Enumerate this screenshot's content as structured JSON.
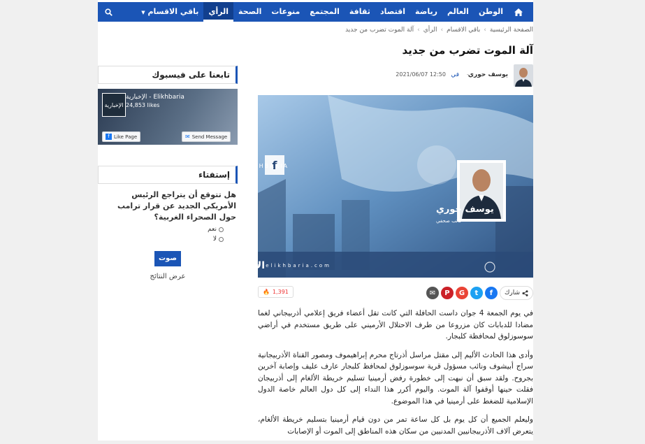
{
  "nav": {
    "items": [
      "الوطن",
      "العالم",
      "رياضة",
      "اقتصاد",
      "ثقافة",
      "المجتمع",
      "منوعات",
      "الصحة",
      "الرأي",
      "باقي الاقسام"
    ],
    "active_index": 8,
    "more_label": "باقي الاقسام",
    "home_icon": "home-icon",
    "search_icon": "search-icon"
  },
  "breadcrumb": [
    "الصفحة الرئيسية",
    "باقي الاقسام",
    "الرأي",
    "آلة الموت تضرب من جديد"
  ],
  "article": {
    "title": "آلة الموت تضرب من جديد",
    "author": "يوسف حوري",
    "preposition": "في",
    "date": "2021/06/07 12:50",
    "share_label": "شارك",
    "views": "1,391",
    "hero": {
      "name": "يوسف حوري",
      "role": "كاتب صحفي",
      "brand": "ELIKHBARIA",
      "logo": "الإخبارية",
      "url": "www.elikhbaria.com"
    },
    "paragraphs": [
      "في يوم الجمعة 4 جوان داست الحافلة التي كانت تقل أعضاء فريق إعلامي أذربيجاني لغما مضادا للدبابات كان مزروعا من طرف الاحتلال الأرميني على طريق مستخدم في أراضي سوسوزلوق لمحافظة كلبجار.",
      "وأدى هذا الحادث الأليم إلى مقتل مراسل أذرتاج محرم إبراهيموف ومصور القناة الأذربيجانية سراج أبيشوف ونائب مسؤول قرية سوسوزلوق لمحافظ كلبجار عارف عليف وإصابة آخرين بجروح. ولقد سبق أن نبهت إلى خطورة رفض أرمينيا تسليم خريطة الألغام إلى أذربيجان فقلت حينها أوقفوا آلة الموت. واليوم أكرر هذا النداء إلى كل دول العالم خاصة الدول الإسلامية للضغط على أرمينيا في هذا الموضوع.",
      "وليعلم الجميع أن كل يوم بل كل ساعة تمر من دون قيام أرمينيا بتسليم خريطة الألغام، يتعرض آلاف الأذربيجانيين المدنيين من سكان هذه المناطق إلى الموت أو الإصابات"
    ]
  },
  "sidebar": {
    "facebook_title": "تابعنا على فيسبوك",
    "fb_page_name": "الإخبارية - Elikhbaria",
    "fb_likes": "24,853 likes",
    "fb_like_button": "Like Page",
    "fb_send_button": "Send Message",
    "fb_logo": "الإخبارية",
    "poll_title": "إستفتاء",
    "poll_question": "هل تتوقع أن يتراجع الرئيس الأمريكي الجديد عن قرار ترامب حول الصحراء الغربية؟",
    "poll_options": [
      "نعم",
      "لا"
    ],
    "vote_button": "صوت",
    "results_link": "عرض النتائج"
  },
  "colors": {
    "brand": "#1b55b6",
    "facebook": "#1877f2",
    "twitter": "#1da1f2",
    "google": "#ea4335",
    "pinterest": "#cb2027",
    "email": "#555555",
    "views": "#e33333"
  }
}
